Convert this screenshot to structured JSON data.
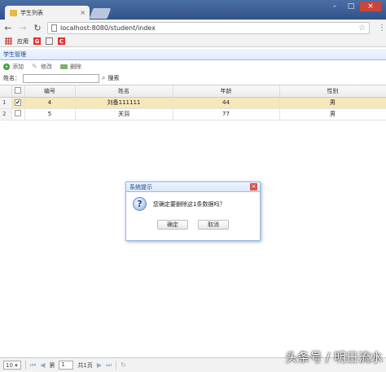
{
  "browser": {
    "tab_title": "学生列表",
    "url": "localhost:8080/student/index",
    "bookmarks_label": "应用",
    "bookmark_g": "G"
  },
  "panel": {
    "title": "学生管理"
  },
  "actions": {
    "add": "添加",
    "edit": "修改",
    "delete": "删除"
  },
  "search": {
    "label": "姓名：",
    "value": "",
    "button": "搜索"
  },
  "grid": {
    "columns": [
      "编号",
      "姓名",
      "年龄",
      "性别"
    ],
    "rows": [
      {
        "rn": "1",
        "checked": true,
        "id": "4",
        "name": "刘备111111",
        "age": "44",
        "gender": "男"
      },
      {
        "rn": "2",
        "checked": false,
        "id": "5",
        "name": "关羽",
        "age": "77",
        "gender": "男"
      }
    ]
  },
  "pager": {
    "page_size": "10",
    "page_prefix": "第",
    "page_value": "1",
    "page_suffix": "共1页"
  },
  "dialog": {
    "title": "系统提示",
    "message": "您确定要删除这1条数据吗？",
    "ok": "确定",
    "cancel": "取消"
  },
  "watermark": "头条号 / 明日流水",
  "colors": {
    "selected_row": "#f6e7b9",
    "header_blue": "#15428b",
    "close_red": "#c9463d"
  }
}
